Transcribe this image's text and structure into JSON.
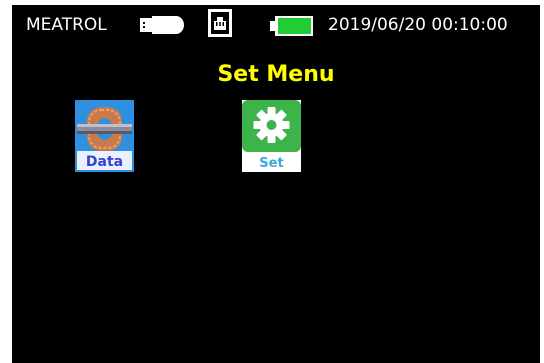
{
  "statusbar": {
    "brand": "MEATROL",
    "datetime": "2019/06/20 00:10:00",
    "icons": {
      "usb": "usb-stick-icon",
      "network": "ethernet-port-icon",
      "battery": "battery-icon"
    },
    "battery_color": "#22cc33"
  },
  "page": {
    "title": "Set Menu",
    "title_color": "#ffff00"
  },
  "apps": [
    {
      "label": "Data",
      "icon": "coil-data-icon",
      "label_color": "#3344cc",
      "background": "#2f8fe0"
    },
    {
      "label": "Set",
      "icon": "gear-settings-icon",
      "label_color": "#3aa8e0",
      "background": "#3cb44a"
    }
  ]
}
